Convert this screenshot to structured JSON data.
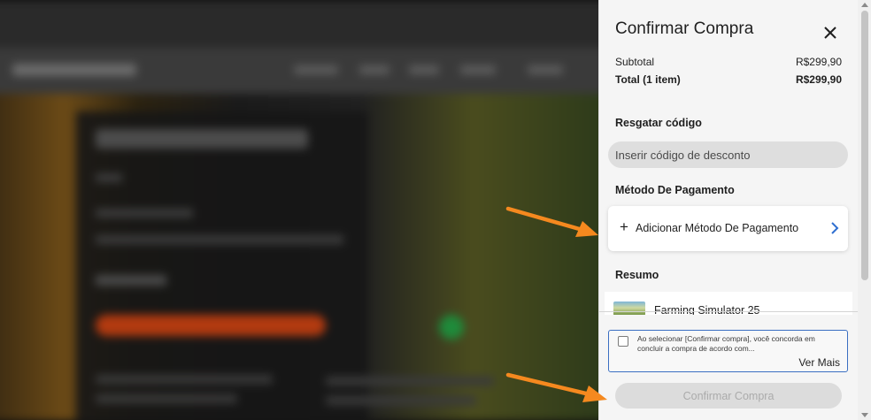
{
  "panel": {
    "title": "Confirmar Compra",
    "subtotal_label": "Subtotal",
    "subtotal_value": "R$299,90",
    "total_label": "Total (1 item)",
    "total_value": "R$299,90",
    "redeem_label": "Resgatar código",
    "code_placeholder": "Inserir código de desconto",
    "payment_label": "Método De Pagamento",
    "add_payment_label": "Adicionar Método De Pagamento",
    "summary_label": "Resumo",
    "game_name": "Farming Simulator 25",
    "consent_text": "Ao selecionar [Confirmar compra], você concorda em concluir a compra de acordo com...",
    "see_more_label": "Ver Mais",
    "confirm_label": "Confirmar Compra"
  },
  "icons": {
    "close": "close-icon",
    "add": "plus-icon",
    "chevron": "chevron-right-icon"
  },
  "colors": {
    "annotation_arrow": "#f5891f",
    "consent_border": "#3b6fc2",
    "chevron": "#2f6fd0"
  }
}
